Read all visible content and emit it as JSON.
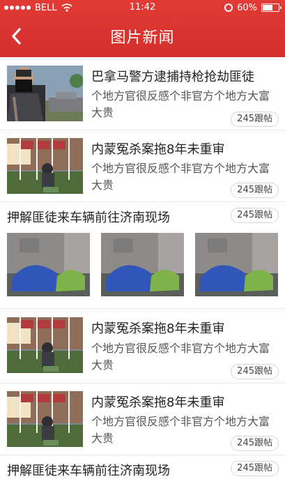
{
  "status": {
    "carrier": "BELL",
    "time": "11:42",
    "battery": "60%"
  },
  "nav": {
    "title": "图片新闻"
  },
  "items": [
    {
      "title": "巴拿马警方逮捕持枪抢劫匪徒",
      "desc": "个地方官很反感个非官方个地方大富大贵",
      "count": "245跟帖"
    },
    {
      "title": "内蒙冤杀案拖8年未重审",
      "desc": "个地方官很反感个非官方个地方大富大贵",
      "count": "245跟帖"
    },
    {
      "title": "押解匪徒来车辆前往济南现场",
      "count": "245跟帖"
    },
    {
      "title": "内蒙冤杀案拖8年未重审",
      "desc": "个地方官很反感个非官方个地方大富大贵",
      "count": "245跟帖"
    },
    {
      "title": "内蒙冤杀案拖8年未重审",
      "desc": "个地方官很反感个非官方个地方大富大贵",
      "count": "245跟帖"
    },
    {
      "title": "押解匪徒来车辆前往济南现场",
      "count": "245跟帖"
    }
  ],
  "icons": {
    "back": "chevron-left-icon",
    "wifi": "wifi-icon",
    "alarm": "alarm-icon",
    "battery": "battery-icon"
  },
  "colors": {
    "header": "#e23a35",
    "text": "#222222",
    "subtext": "#555555"
  }
}
